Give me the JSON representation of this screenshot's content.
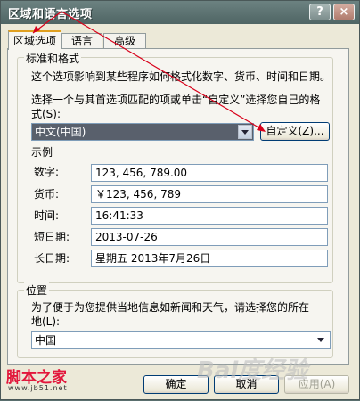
{
  "window": {
    "title": "区域和语言选项",
    "help_btn": "?",
    "close_btn": "×"
  },
  "tabs": [
    {
      "label": "区域选项",
      "active": true
    },
    {
      "label": "语言",
      "active": false
    },
    {
      "label": "高级",
      "active": false
    }
  ],
  "standards": {
    "group_label": "标准和格式",
    "description": "这个选项影响到某些程序如何格式化数字、货币、时间和日期。",
    "instruction_line1": "选择一个与其首选项匹配的项或单击“自定义”选择您自己的格",
    "instruction_line2": "式(S):",
    "locale_value": "中文(中国)",
    "customize_button": "自定义(Z)...",
    "examples_label": "示例",
    "examples": [
      {
        "label": "数字:",
        "value": "123, 456, 789.00"
      },
      {
        "label": "货币:",
        "value": "￥123, 456, 789"
      },
      {
        "label": "时间:",
        "value": "16:41:33"
      },
      {
        "label": "短日期:",
        "value": "2013-07-26"
      },
      {
        "label": "长日期:",
        "value": "星期五  2013年7月26日"
      }
    ]
  },
  "location": {
    "group_label": "位置",
    "description_line1": "为了便于为您提供当地信息如新闻和天气，请选择您的所在",
    "description_line2": "地(L):",
    "value": "中国"
  },
  "buttons": {
    "ok": "确定",
    "cancel": "取消",
    "apply": "应用(A)"
  },
  "watermark": {
    "line1": "脚本之家",
    "line2": "www.jb51.net",
    "line3": "Bai度经验"
  },
  "colors": {
    "annotation_arrow": "#d8001a"
  }
}
